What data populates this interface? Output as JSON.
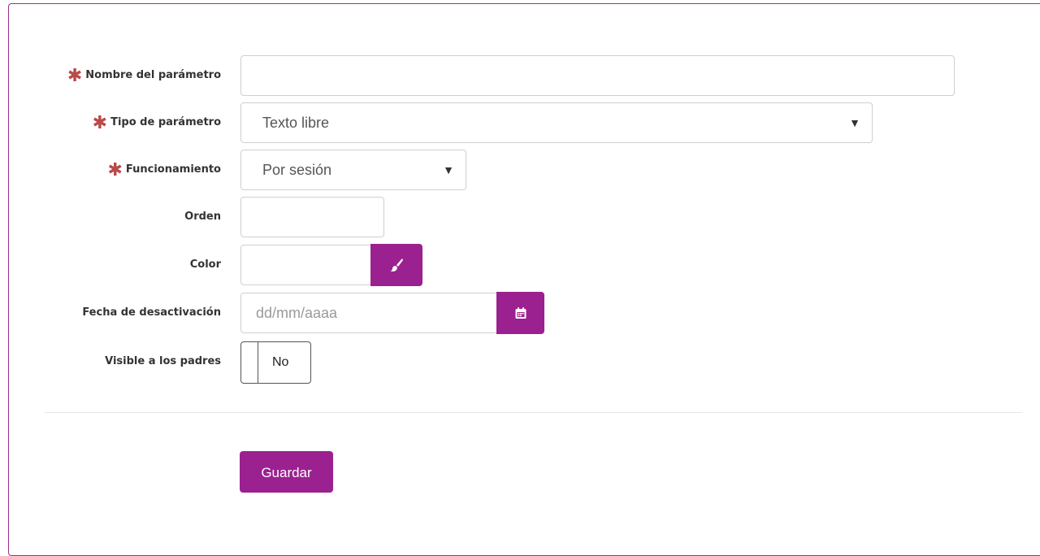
{
  "form": {
    "nombre": {
      "label": "Nombre del parámetro",
      "required_mark": "✱",
      "value": ""
    },
    "tipo": {
      "label": "Tipo de parámetro",
      "required_mark": "✱",
      "selected": "Texto libre"
    },
    "funcionamiento": {
      "label": "Funcionamiento",
      "required_mark": "✱",
      "selected": "Por sesión"
    },
    "orden": {
      "label": "Orden",
      "value": ""
    },
    "color": {
      "label": "Color",
      "value": "",
      "button_icon": "paintbrush-icon"
    },
    "fecha": {
      "label": "Fecha de desactivación",
      "placeholder": "dd/mm/aaaa",
      "button_icon": "calendar-icon"
    },
    "visible": {
      "label": "Visible a los padres",
      "toggle_text": "No",
      "checked": false
    }
  },
  "actions": {
    "save_label": "Guardar"
  },
  "colors": {
    "accent": "#9b2190",
    "required": "#b94a48",
    "border": "#9b2f8f"
  }
}
